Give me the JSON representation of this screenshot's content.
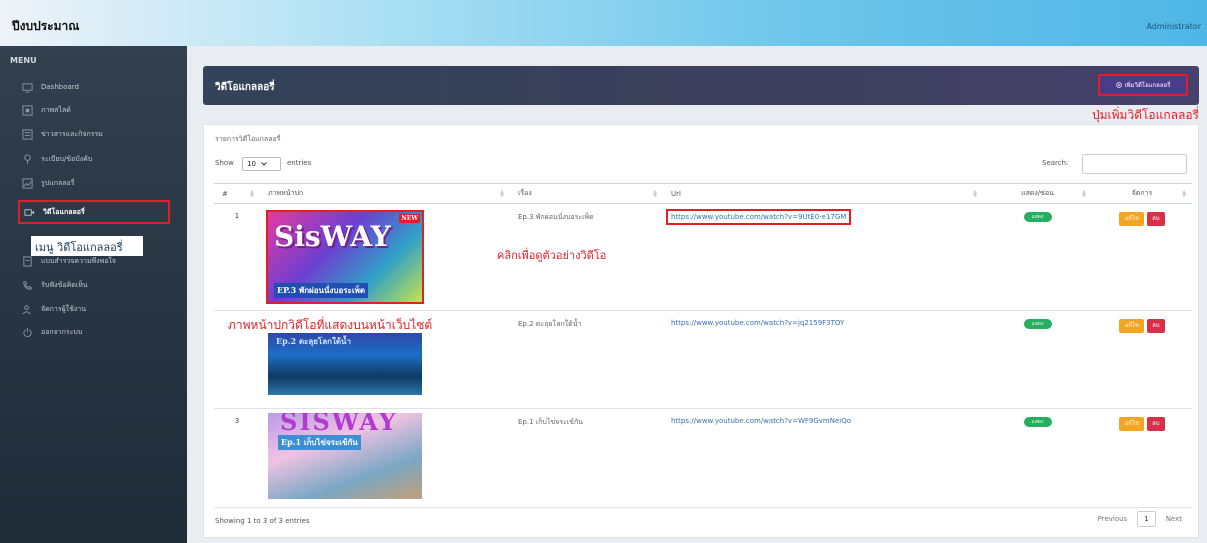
{
  "app": {
    "title": "ปีงบประมาณ",
    "user": "Administrator"
  },
  "sidebar": {
    "menu_title": "MENU",
    "items": [
      {
        "label": "Dashboard",
        "icon": "monitor-icon"
      },
      {
        "label": "ภาพสไลด์",
        "icon": "slides-icon"
      },
      {
        "label": "ข่าวสารและกิจกรรม",
        "icon": "news-icon"
      },
      {
        "label": "ระเบียบ/ข้อบังคับ",
        "icon": "rule-icon"
      },
      {
        "label": "รูปแกลลอรี่",
        "icon": "image-icon"
      },
      {
        "label": "วิดีโอแกลลอรี่",
        "icon": "video-icon"
      },
      {
        "label": "แบบสำรวจความพึงพอใจ",
        "icon": "survey-icon"
      },
      {
        "label": "รับฟังข้อคิดเห็น",
        "icon": "phone-icon"
      },
      {
        "label": "จัดการผู้ใช้งาน",
        "icon": "users-icon"
      },
      {
        "label": "ออกจากระบบ",
        "icon": "power-icon"
      }
    ],
    "callout": "เมนู วิดีโอแกลลอรี่"
  },
  "header": {
    "title": "วิดีโอแกลลอรี่",
    "add_button": "เพิ่มวิดีโอแกลลอรี่",
    "add_callout": "ปุ่มเพิ่มวิดีโอแกลลอรี่"
  },
  "card": {
    "title": "รายการวิดีโอแกลลอรี่",
    "show_label": "Show",
    "page_size": "10",
    "entries_label": "entries",
    "search_label": "Search:",
    "search_value": ""
  },
  "table": {
    "columns": [
      "#",
      "ภาพหน้าปก",
      "เรื่อง",
      "Url",
      "แสดง/ซ่อน",
      "จัดการ"
    ],
    "rows": [
      {
        "num": "1",
        "title": "Ep.3 พักผ่อนนั่งบอระเพ็ด",
        "url": "https://www.youtube.com/watch?v=9UtE0-e17GM",
        "status": "แสดง",
        "edit": "แก้ไข",
        "delete": "ลบ",
        "thumb_text": "SisWAY",
        "thumb_sub": "EP.3 พักผ่อนนั่งบอระเพ็ด",
        "thumb_badge": "NEW"
      },
      {
        "num": "",
        "title": "Ep.2 ตะลุยโลกใต้น้ำ",
        "url": "https://www.youtube.com/watch?v=jq2159F3TOY",
        "status": "แสดง",
        "edit": "แก้ไข",
        "delete": "ลบ",
        "thumb_text": "Ep.2 ตะลุยโลกใต้น้ำ"
      },
      {
        "num": "3",
        "title": "Ep.1 เก็บไข่จระเข้กัน",
        "url": "https://www.youtube.com/watch?v=WF9GvmNeiQo",
        "status": "แสดง",
        "edit": "แก้ไข",
        "delete": "ลบ",
        "thumb_text": "SISWAY",
        "thumb_sub": "Ep.1 เก็บไข่จระเข้กัน"
      }
    ]
  },
  "callouts": {
    "video": "คลิกเพื่อดูตัวอย่างวิดีโอ",
    "cover": "ภาพหน้าปกวิดีโอที่แสดงบนหน้าเว็บไซต์"
  },
  "footer": {
    "info": "Showing 1 to 3 of 3 entries",
    "previous": "Previous",
    "page": "1",
    "next": "Next"
  },
  "colors": {
    "accent_red": "#e21f26",
    "header_bg": "#3e3f5c",
    "sidebar_bg": "#2a3642",
    "status_green": "#27ae60",
    "edit_orange": "#f4a623",
    "delete_red": "#d9304a"
  }
}
